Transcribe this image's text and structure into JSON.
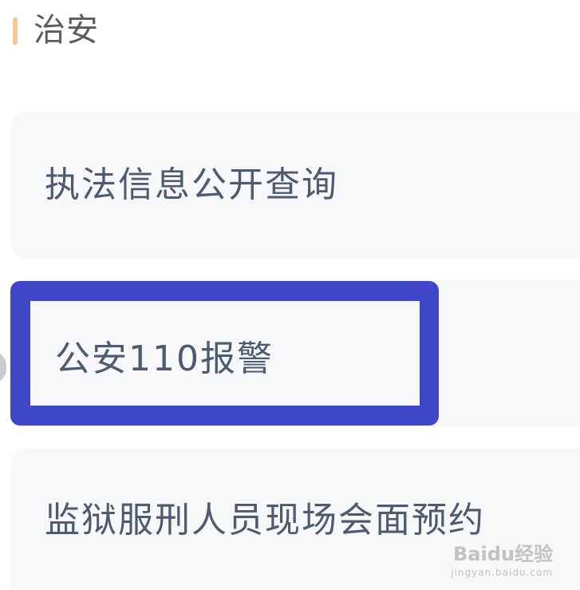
{
  "section": {
    "title": "治安"
  },
  "services": [
    {
      "label": "执法信息公开查询"
    },
    {
      "label": "公安110报警"
    },
    {
      "label": "监狱服刑人员现场会面预约"
    }
  ],
  "watermark": {
    "main": "Baidu经验",
    "sub": "jingyan.baidu.com"
  },
  "colors": {
    "accent": "#f8c894",
    "highlight": "#4046c8",
    "card_bg": "#f7f8fa",
    "text": "#4e5a70"
  }
}
